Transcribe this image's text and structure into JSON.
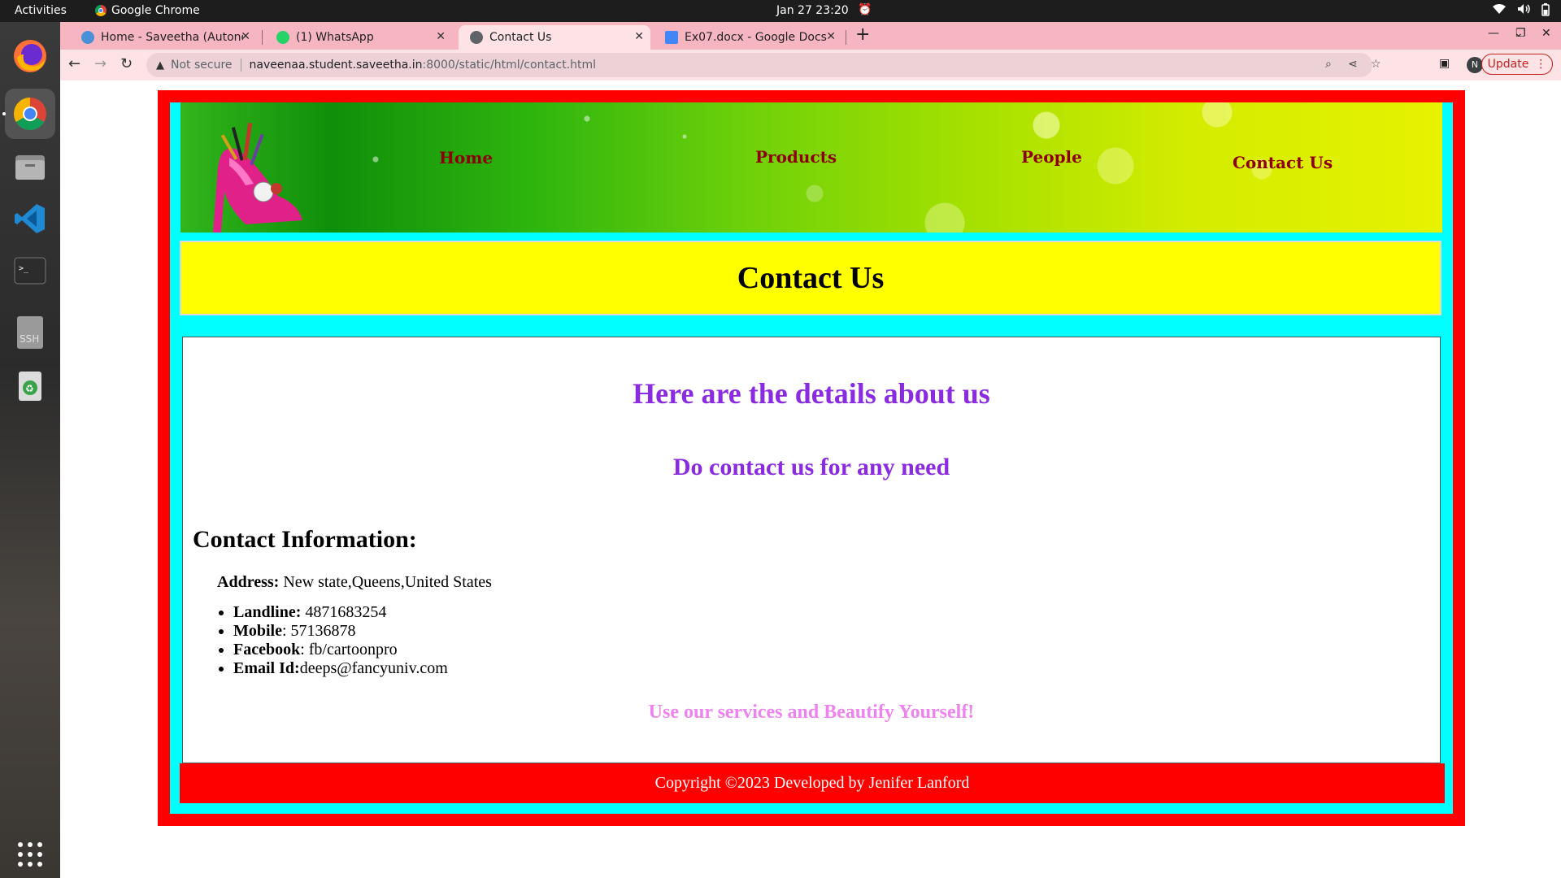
{
  "topbar": {
    "activities": "Activities",
    "app_name": "Google Chrome",
    "clock": "Jan 27  23:20"
  },
  "tabs": [
    {
      "title": "Home - Saveetha (Autono",
      "favicon_color": "#4a90d9"
    },
    {
      "title": "(1) WhatsApp",
      "favicon_color": "#25d366"
    },
    {
      "title": "Contact Us",
      "favicon_color": "#5f6368"
    },
    {
      "title": "Ex07.docx - Google Docs",
      "favicon_color": "#4285f4"
    }
  ],
  "omnibox": {
    "security": "Not secure",
    "host": "naveenaa.student.saveetha.in",
    "path": ":8000/static/html/contact.html"
  },
  "profile_initial": "N",
  "update_label": "Update",
  "site": {
    "nav": [
      "Home",
      "Products",
      "People",
      "Contact Us"
    ],
    "page_title": "Contact Us",
    "heading": "Here are the details about us",
    "subheading": "Do contact us for any need",
    "contact_heading": "Contact Information:",
    "address_label": "Address:",
    "address_value": " New state,Queens,United States",
    "contacts": [
      {
        "label": "Landline:",
        "value": " 4871683254"
      },
      {
        "label": "Mobile",
        "value": ": 57136878"
      },
      {
        "label": "Facebook",
        "value": ": fb/cartoonpro"
      },
      {
        "label": "Email Id:",
        "value": "deeps@fancyuniv.com"
      }
    ],
    "tagline": "Use our services and Beautify Yourself!",
    "footer": "Copyright ©2023 Developed by Jenifer Lanford"
  },
  "colors": {
    "page_border": "#ff0000",
    "page_bg": "#00ffff",
    "title_bg": "#ffff00",
    "heading": "#8a2be2",
    "tagline": "#ee82ee",
    "nav_text": "#8b0000"
  }
}
